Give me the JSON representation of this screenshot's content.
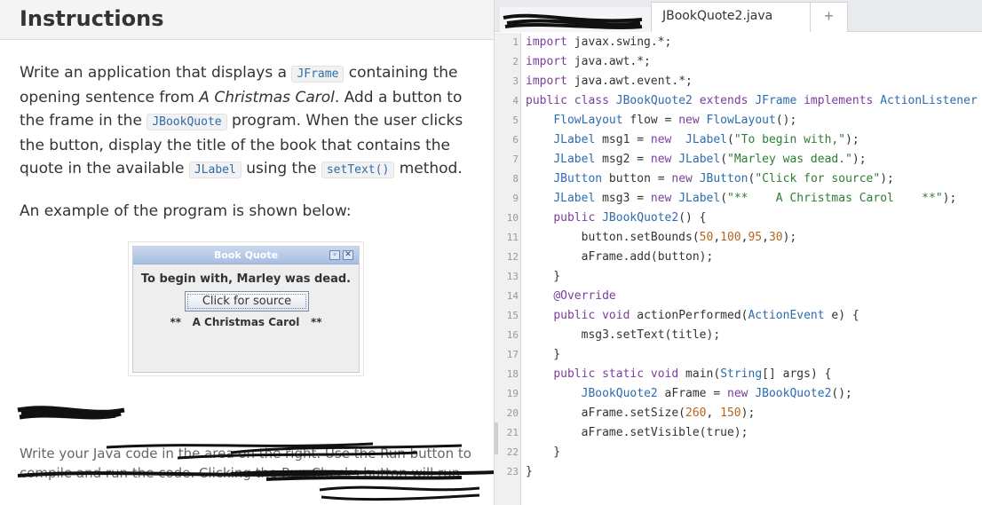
{
  "left": {
    "header": "Instructions",
    "p1": {
      "t1": "Write an application that displays a ",
      "c1": "JFrame",
      "t2": " containing the opening sentence from ",
      "book": "A Christmas Carol",
      "t3": ". Add a button to the frame in the ",
      "c2": "JBookQuote",
      "t4": " program. When the user clicks the button, display the title of the book that contains the quote in the available ",
      "c3": "JLabel",
      "t5": " using the ",
      "c4": "setText()",
      "t6": " method."
    },
    "p2": "An example of the program is shown below:",
    "example": {
      "title": "Book Quote",
      "min_glyph": "▫",
      "close_glyph": "✕",
      "msg1": "To begin with, Marley was dead.",
      "button": "Click for source",
      "msg3": "**   A Christmas Carol   **"
    },
    "p3": {
      "line1": "Write your Java code in the area on the right. Use the Run button to",
      "line2": "compile and run the code. Clicking the Run Checks button will run"
    }
  },
  "editor": {
    "tab_title": "JBookQuote2.java",
    "add_tab": "+",
    "lines": [
      "import javax.swing.*;",
      "import java.awt.*;",
      "import java.awt.event.*;",
      "public class JBookQuote2 extends JFrame implements ActionListener {",
      "    FlowLayout flow = new FlowLayout();",
      "    JLabel msg1 = new  JLabel(\"To begin with,\");",
      "    JLabel msg2 = new JLabel(\"Marley was dead.\");",
      "    JButton button = new JButton(\"Click for source\");",
      "    JLabel msg3 = new JLabel(\"**    A Christmas Carol    **\");",
      "    public JBookQuote2() {",
      "        button.setBounds(50,100,95,30);",
      "        aFrame.add(button);",
      "    }",
      "    @Override",
      "    public void actionPerformed(ActionEvent e) {",
      "        msg3.setText(title);",
      "    }",
      "    public static void main(String[] args) {",
      "        JBookQuote2 aFrame = new JBookQuote2();",
      "        aFrame.setSize(260, 150);",
      "        aFrame.setVisible(true);",
      "    }",
      "}"
    ]
  }
}
